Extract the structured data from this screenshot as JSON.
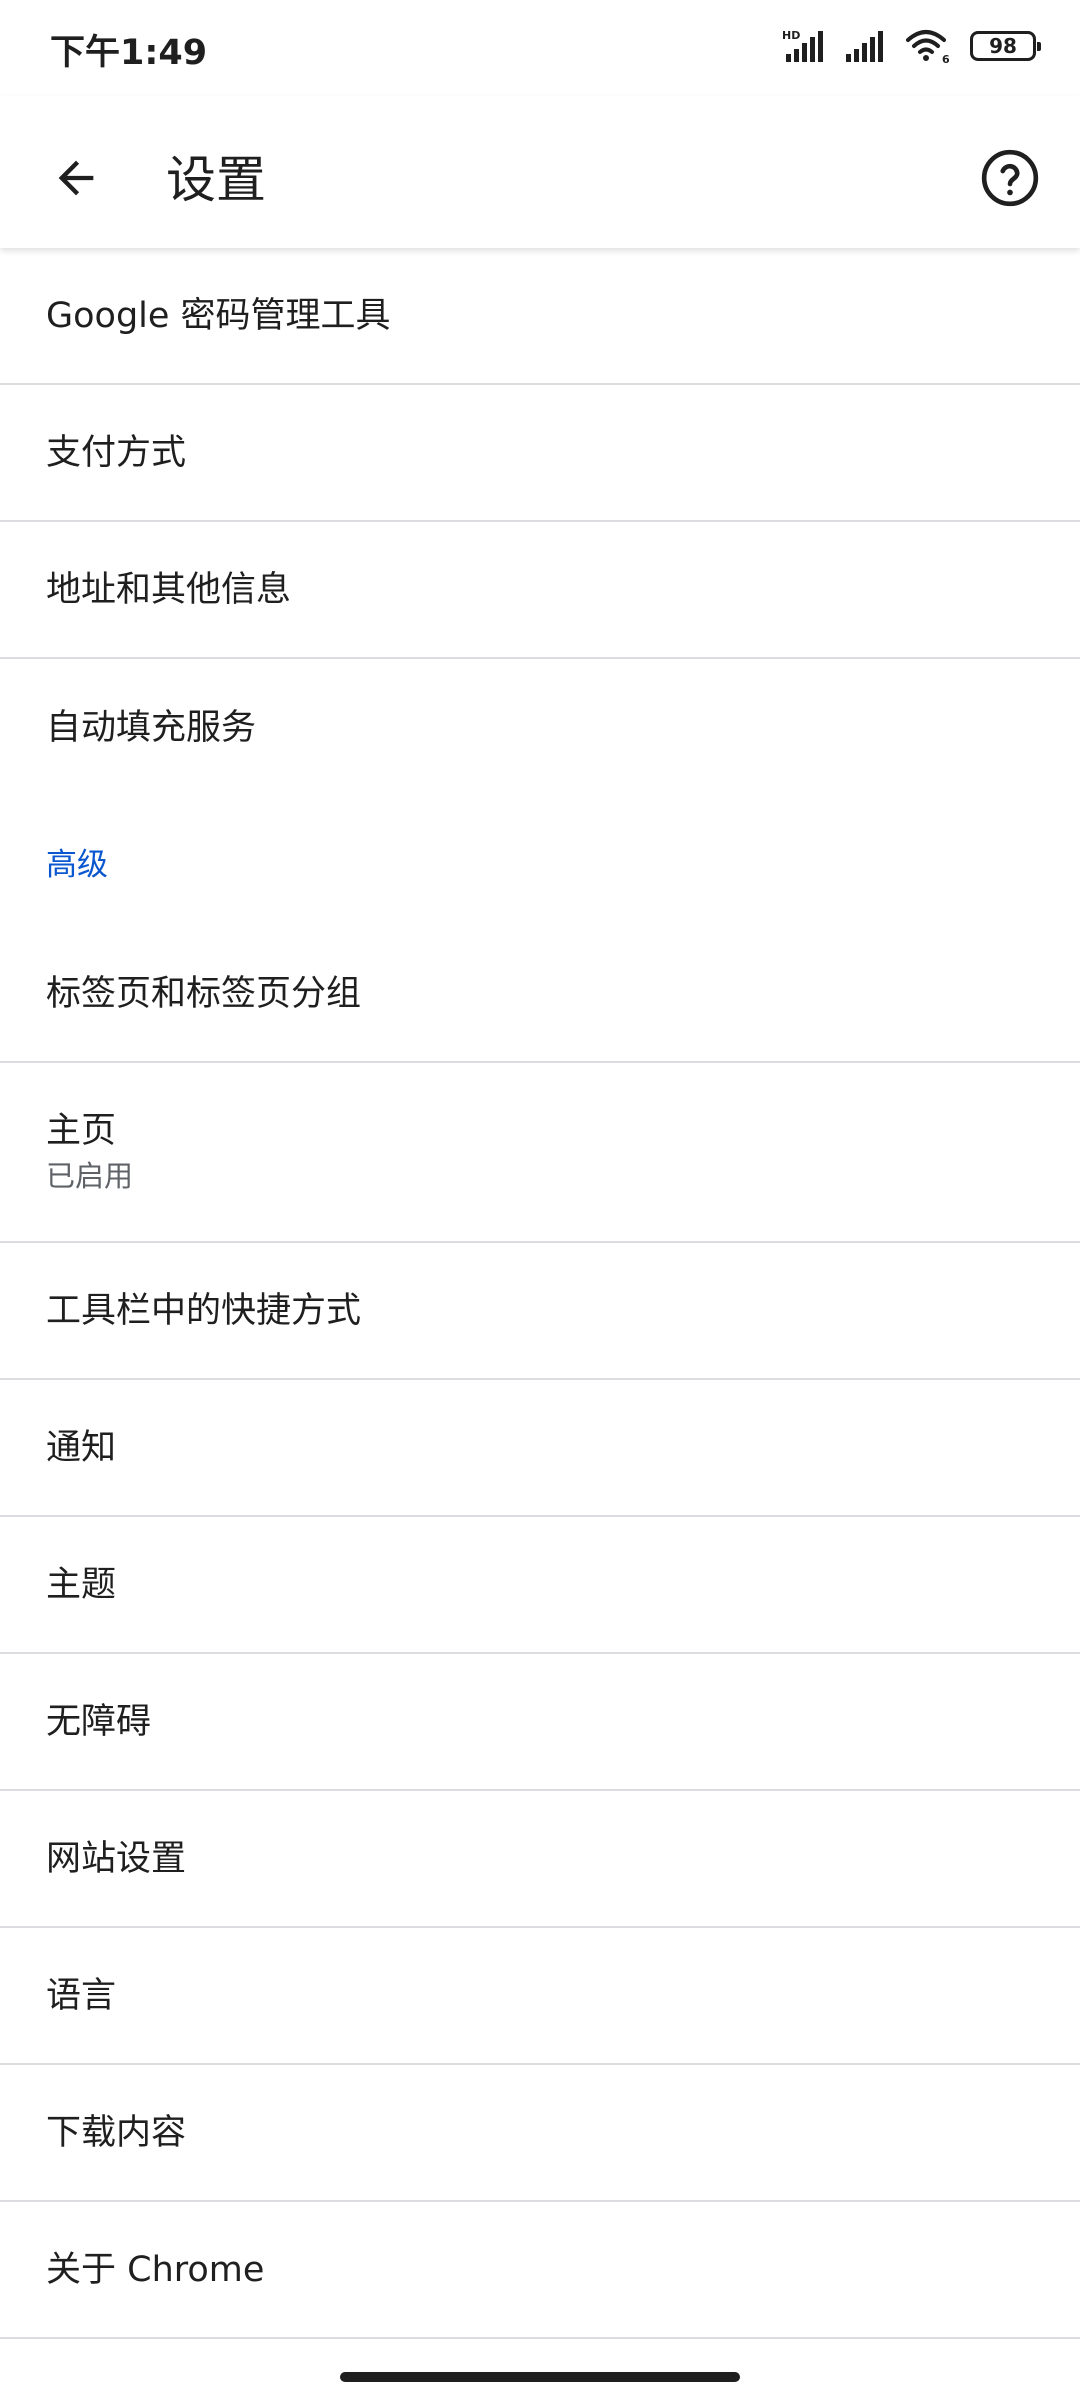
{
  "status_bar": {
    "time": "下午1:49",
    "network_label": "HD",
    "wifi_label": "6",
    "battery_level": "98"
  },
  "app_bar": {
    "title": "设置",
    "back_icon": "arrow-back-icon",
    "help_icon": "help-circle-icon"
  },
  "settings": {
    "top_items": [
      {
        "title": "Google 密码管理工具"
      },
      {
        "title": "支付方式"
      },
      {
        "title": "地址和其他信息"
      },
      {
        "title": "自动填充服务"
      }
    ],
    "advanced_header": "高级",
    "advanced_items": [
      {
        "title": "标签页和标签页分组"
      },
      {
        "title": "主页",
        "summary": "已启用"
      },
      {
        "title": "工具栏中的快捷方式"
      },
      {
        "title": "通知"
      },
      {
        "title": "主题"
      },
      {
        "title": "无障碍"
      },
      {
        "title": "网站设置"
      },
      {
        "title": "语言"
      },
      {
        "title": "下载内容"
      },
      {
        "title": "关于 Chrome"
      }
    ]
  },
  "colors": {
    "accent": "#0b57d0",
    "divider": "#dadce0",
    "text_primary": "#1f1f1f",
    "text_secondary": "#5f6368"
  }
}
